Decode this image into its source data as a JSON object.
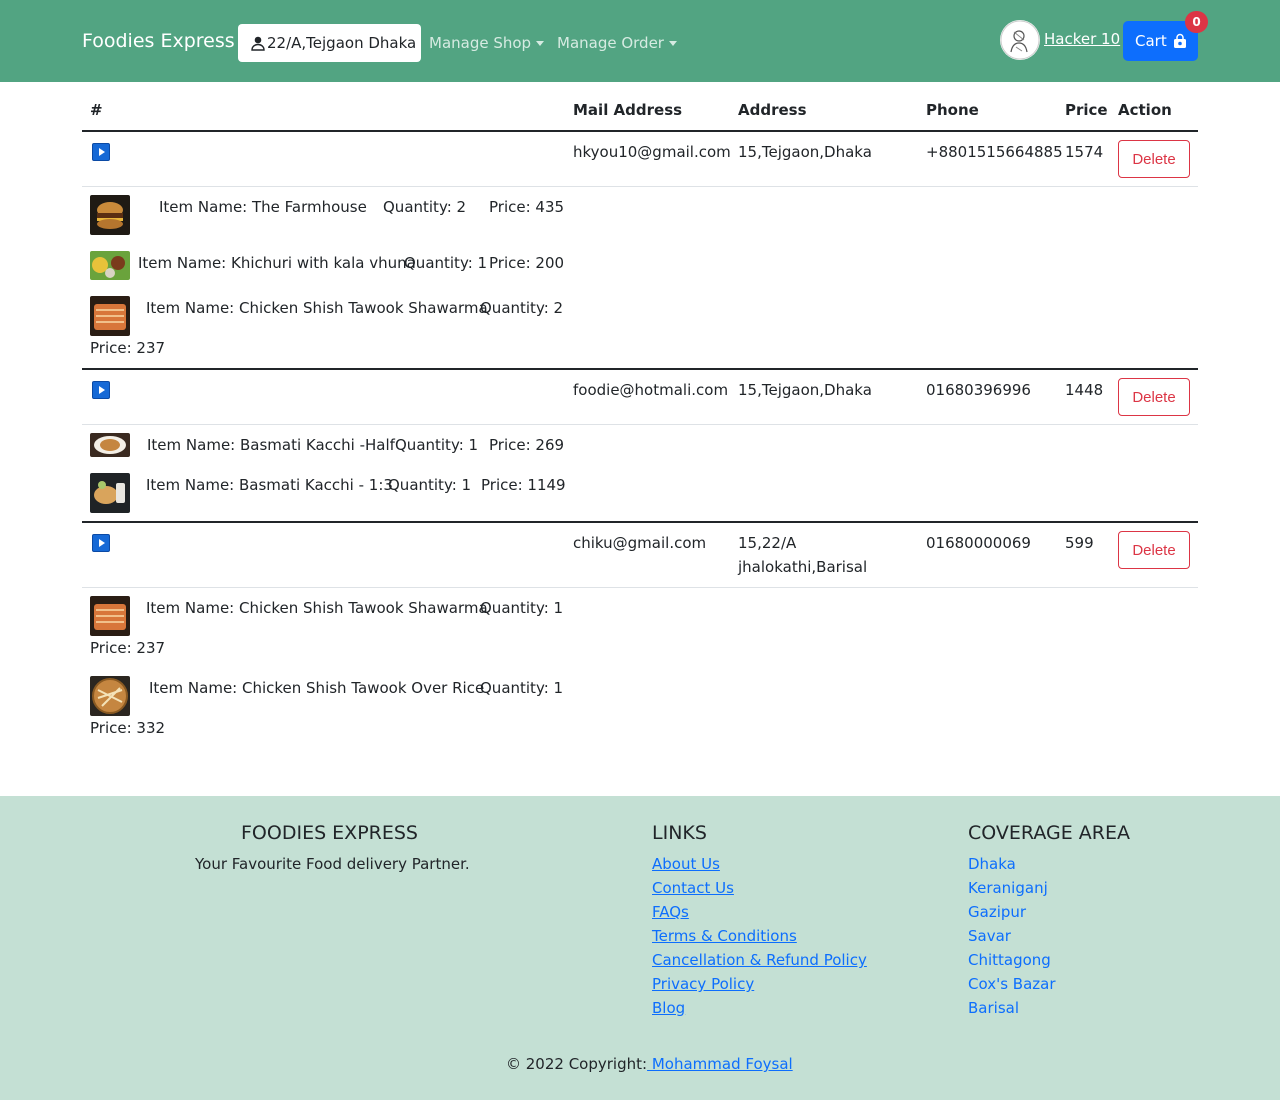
{
  "navbar": {
    "brand": "Foodies Express",
    "location": "22/A,Tejgaon Dhaka",
    "manage_shop": "Manage Shop",
    "manage_order": "Manage Order",
    "user_name": "Hacker 10",
    "cart_label": "Cart",
    "cart_count": "0"
  },
  "table": {
    "headers": [
      "#",
      "Mail Address",
      "Address",
      "Phone",
      "Price",
      "Action"
    ],
    "delete_label": "Delete"
  },
  "orders": [
    {
      "mail": "hkyou10@gmail.com",
      "address": "15,Tejgaon,Dhaka",
      "phone": "+8801515664885",
      "price": "1574",
      "items": [
        {
          "name": "Item Name: The Farmhouse",
          "qty": "Quantity: 2",
          "price": "Price: 435"
        },
        {
          "name": "Item Name: Khichuri with kala vhuna",
          "qty": "Quantity: 1",
          "price": "Price: 200"
        },
        {
          "name": "Item Name: Chicken Shish Tawook Shawarma",
          "qty": "Quantity: 2",
          "price": "Price: 237"
        }
      ]
    },
    {
      "mail": "foodie@hotmali.com",
      "address": "15,Tejgaon,Dhaka",
      "phone": "01680396996",
      "price": "1448",
      "items": [
        {
          "name": "Item Name: Basmati Kacchi -Half",
          "qty": "Quantity: 1",
          "price": "Price: 269"
        },
        {
          "name": "Item Name: Basmati Kacchi - 1:3",
          "qty": "Quantity: 1",
          "price": "Price: 1149"
        }
      ]
    },
    {
      "mail": "chiku@gmail.com",
      "address_line1": "15,22/A",
      "address_line2": "jhalokathi,Barisal",
      "phone": "01680000069",
      "price": "599",
      "items": [
        {
          "name": "Item Name: Chicken Shish Tawook Shawarma",
          "qty": "Quantity: 1",
          "price": "Price: 237"
        },
        {
          "name": "Item Name: Chicken Shish Tawook Over Rice",
          "qty": "Quantity: 1",
          "price": "Price: 332"
        }
      ]
    }
  ],
  "footer": {
    "brand_title": "FOODIES EXPRESS",
    "tagline": "Your Favourite Food delivery Partner.",
    "links_title": "LINKS",
    "links": [
      "About Us",
      "Contact Us",
      "FAQs",
      "Terms & Conditions",
      "Cancellation & Refund Policy",
      "Privacy Policy",
      "Blog"
    ],
    "coverage_title": "COVERAGE AREA",
    "coverage": [
      "Dhaka",
      "Keraniganj",
      "Gazipur",
      "Savar",
      "Chittagong",
      "Cox's Bazar",
      "Barisal"
    ],
    "copyright": "© 2022 Copyright:",
    "author": " Mohammad Foysal"
  },
  "colors": {
    "navbar": "#52a482",
    "footer": "#c4e0d4",
    "primary": "#0d6efd",
    "danger": "#dc3545"
  }
}
